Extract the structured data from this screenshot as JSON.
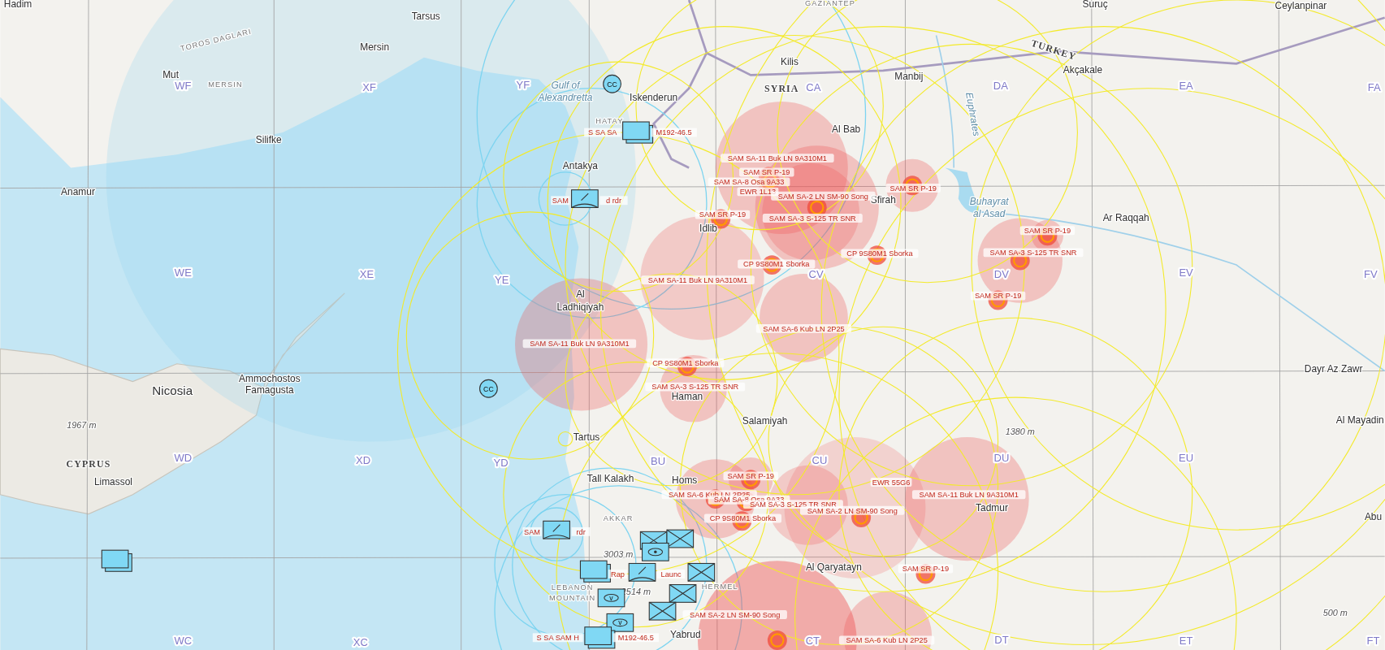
{
  "places": [
    "Hadim",
    "Tarsus",
    "TOROS DAGLARI",
    "Mersin",
    "Mut",
    "MERSIN",
    "Silifke",
    "Anamur",
    "Gulf of",
    "Alexandretta",
    "Iskenderun",
    "HATAY",
    "Antakya",
    "Kilis",
    "SYRIA",
    "GAZIANTEP",
    "Suruç",
    "Ceylanpinar",
    "TURKEY",
    "Akçakale",
    "Manbij",
    "Al Bab",
    "Euphrates",
    "Buhayrat",
    "al Asad",
    "Ar Raqqah",
    "Al",
    "Ladhiqiyah",
    "Nicosia",
    "Ammochostos",
    "Famagusta",
    "1967 m",
    "CYPRUS",
    "Limassol",
    "Tartus",
    "Haman",
    "Salamiyah",
    "Tall Kalakh",
    "Homs",
    "AKKAR",
    "Tadmur",
    "1380 m",
    "Al Qaryatayn",
    "3003 m",
    "HERMEL",
    "LEBANON",
    "MOUNTAIN",
    "2514 m",
    "Yabrud",
    "Dayr Az Zawr",
    "Al Mayadin",
    "Abu",
    "500 m",
    "Idlib",
    "Sfirah"
  ],
  "grid_labels": [
    "WF",
    "XF",
    "YF",
    "CA",
    "DA",
    "EA",
    "FA",
    "WE",
    "XE",
    "YE",
    "CV",
    "DV",
    "EV",
    "FV",
    "WD",
    "XD",
    "YD",
    "BU",
    "CU",
    "DU",
    "EU",
    "WC",
    "XC",
    "CT",
    "DT",
    "ET",
    "FT"
  ],
  "threats": [
    {
      "label": "SAM SA-11 Buk LN 9A310M1"
    },
    {
      "label": "SAM SR P-19"
    },
    {
      "label": "SAM SA-8 Osa 9A33"
    },
    {
      "label": "EWR 1L13"
    },
    {
      "label": "SAM SA-2 LN SM-90 Song"
    },
    {
      "label": "SAM SA-3 S-125 TR SNR"
    },
    {
      "label": "SAM SR P-19"
    },
    {
      "label": "SAM SR P-19"
    },
    {
      "label": "CP 9S80M1 Sborka"
    },
    {
      "label": "CP 9S80M1 Sborka"
    },
    {
      "label": "SAM SA-11 Buk LN 9A310M1"
    },
    {
      "label": "SAM SA-11 Buk LN 9A310M1"
    },
    {
      "label": "SAM SA-6 Kub LN 2P25"
    },
    {
      "label": "CP 9S80M1 Sborka"
    },
    {
      "label": "SAM SA-3 S-125 TR SNR"
    },
    {
      "label": "SAM SR P-19"
    },
    {
      "label": "SAM SA-3 S-125 TR SNR"
    },
    {
      "label": "SAM SR P-19"
    },
    {
      "label": "SAM SR P-19"
    },
    {
      "label": "SAM SA-6 Kub LN 2P25"
    },
    {
      "label": "SAM SA-8 Osa 9A33"
    },
    {
      "label": "SAM SA-3 S-125 TR SNR"
    },
    {
      "label": "CP 9S80M1 Sborka"
    },
    {
      "label": "EWR 55G6"
    },
    {
      "label": "SAM SA-2 LN SM-90 Song"
    },
    {
      "label": "SAM SA-11 Buk LN 9A310M1"
    },
    {
      "label": "SAM SR P-19"
    },
    {
      "label": "SAM SA-2 LN SM-90 Song"
    },
    {
      "label": "SAM SA-6 Kub LN 2P25"
    }
  ],
  "units": [
    {
      "kind": "blank",
      "labels": [
        "S SA SA",
        "M192-46.5"
      ]
    },
    {
      "kind": "radar",
      "labels": [
        "SAM",
        "d rdr"
      ]
    },
    {
      "kind": "circle",
      "symbol": "CC"
    },
    {
      "kind": "circle",
      "symbol": "CC"
    },
    {
      "kind": "blank"
    },
    {
      "kind": "radar",
      "labels": [
        "SAM",
        "rdr"
      ]
    },
    {
      "kind": "cross"
    },
    {
      "kind": "cross"
    },
    {
      "kind": "oval"
    },
    {
      "kind": "blank"
    },
    {
      "kind": "radar",
      "labels": [
        "Rap",
        "Launc"
      ]
    },
    {
      "kind": "cross"
    },
    {
      "kind": "cross"
    },
    {
      "kind": "oval",
      "symbol": "v"
    },
    {
      "kind": "oval",
      "symbol": "v"
    },
    {
      "kind": "cross"
    },
    {
      "kind": "blank",
      "labels": [
        "S SA SAM H",
        "M192-46.5"
      ]
    }
  ]
}
